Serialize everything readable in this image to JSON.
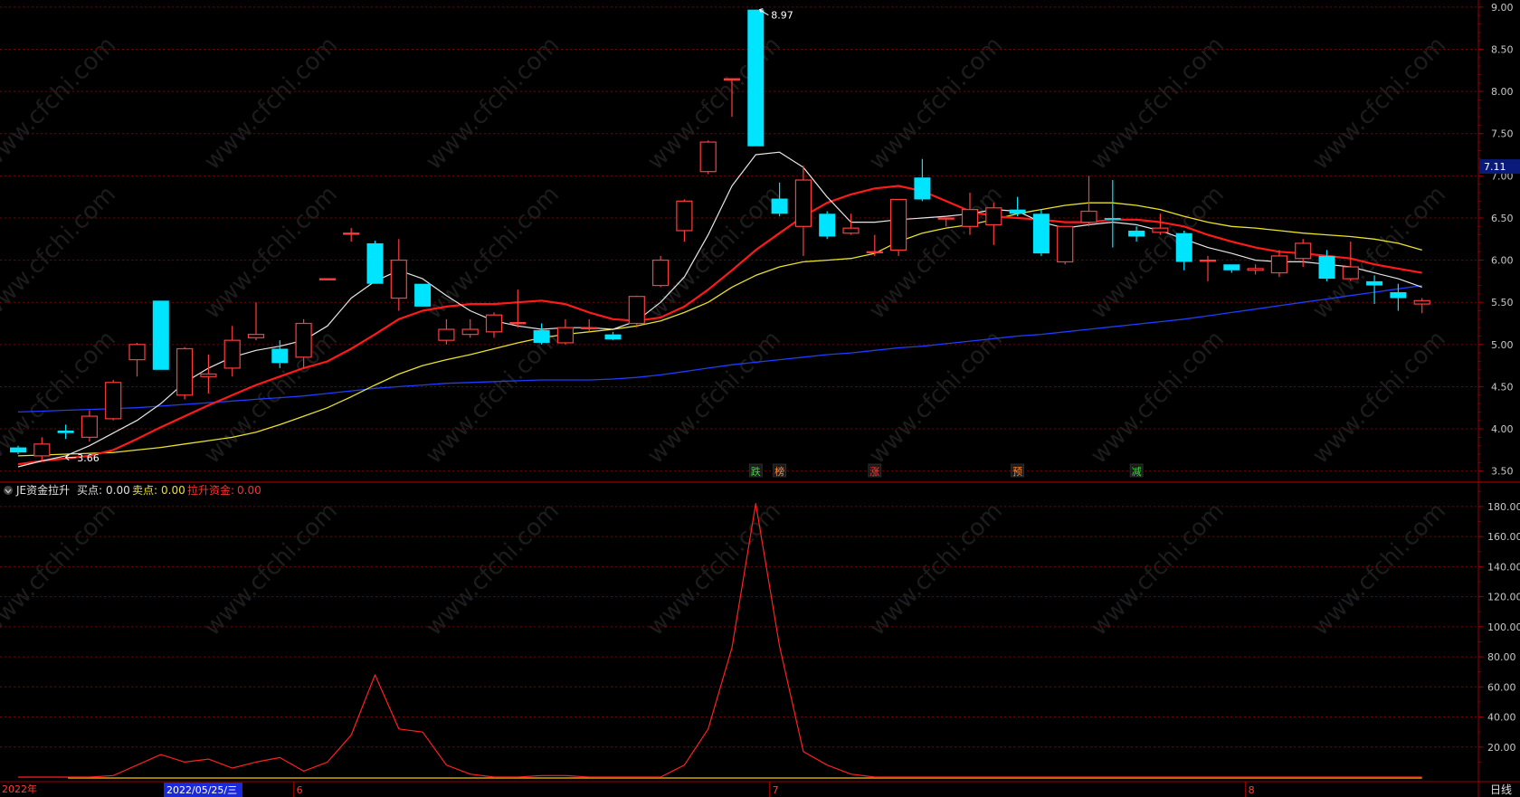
{
  "colors": {
    "background": "#000000",
    "grid": "#7a0000",
    "frame": "#9b0000",
    "up": "#ff3c3c",
    "down": "#00e5ff",
    "ma5": "#e6e6e6",
    "ma10": "#ff1a1a",
    "ma20": "#e8e22a",
    "ma60": "#1f3cff",
    "indicator": "#ff2020",
    "zero_line": "#d4a400",
    "axis_text": "#c8c8c8",
    "current_price_bg": "#0a1a7a",
    "date_bg": "#1a2ad8"
  },
  "main_panel": {
    "price_axis_ticks": [
      "9.00",
      "8.50",
      "8.00",
      "7.50",
      "7.00",
      "6.50",
      "6.00",
      "5.50",
      "5.00",
      "4.50",
      "4.00",
      "3.50"
    ],
    "current_price": "7.11",
    "high_annotation": "8.97",
    "low_annotation": "3.66",
    "event_markers": [
      {
        "label": "跌",
        "color": "#33dd33",
        "index": 31
      },
      {
        "label": "榜",
        "color": "#ff8a3c",
        "index": 32
      },
      {
        "label": "涨",
        "color": "#ff3c3c",
        "index": 36
      },
      {
        "label": "预",
        "color": "#ff8a3c",
        "index": 42
      },
      {
        "label": "减",
        "color": "#33dd33",
        "index": 47
      }
    ]
  },
  "indicator_panel": {
    "name": "JE资金拉升",
    "buy_label": "买点:",
    "buy_value": "0.00",
    "sell_label": "卖点:",
    "sell_value": "0.00",
    "rise_label": "拉升资金:",
    "rise_value": "0.00",
    "axis_ticks": [
      "180.00",
      "160.00",
      "140.00",
      "120.00",
      "100.00",
      "80.00",
      "60.00",
      "40.00",
      "20.00"
    ]
  },
  "date_axis": {
    "year": "2022年",
    "cursor_date": "2022/05/25/三",
    "months": [
      {
        "label": "6",
        "index": 12
      },
      {
        "label": "7",
        "index": 32
      },
      {
        "label": "8",
        "index": 52
      }
    ],
    "period": "日线"
  },
  "chart_data": {
    "type": "line",
    "candles": [
      {
        "o": 3.78,
        "h": 3.8,
        "l": 3.7,
        "c": 3.72
      },
      {
        "o": 3.68,
        "h": 3.9,
        "l": 3.62,
        "c": 3.82
      },
      {
        "o": 3.98,
        "h": 4.05,
        "l": 3.88,
        "c": 3.95
      },
      {
        "o": 3.9,
        "h": 4.22,
        "l": 3.85,
        "c": 4.15
      },
      {
        "o": 4.12,
        "h": 4.58,
        "l": 4.1,
        "c": 4.55
      },
      {
        "o": 4.82,
        "h": 5.02,
        "l": 4.62,
        "c": 5.0
      },
      {
        "o": 5.52,
        "h": 5.52,
        "l": 4.7,
        "c": 4.7
      },
      {
        "o": 4.4,
        "h": 4.97,
        "l": 4.35,
        "c": 4.95
      },
      {
        "o": 4.62,
        "h": 4.88,
        "l": 4.42,
        "c": 4.65
      },
      {
        "o": 4.72,
        "h": 5.22,
        "l": 4.62,
        "c": 5.05
      },
      {
        "o": 5.08,
        "h": 5.5,
        "l": 5.05,
        "c": 5.12
      },
      {
        "o": 4.95,
        "h": 5.05,
        "l": 4.72,
        "c": 4.78
      },
      {
        "o": 4.85,
        "h": 5.3,
        "l": 4.72,
        "c": 5.25
      },
      {
        "o": 5.78,
        "h": 5.78,
        "l": 5.76,
        "c": 5.78
      },
      {
        "o": 6.32,
        "h": 6.38,
        "l": 6.22,
        "c": 6.32
      },
      {
        "o": 6.2,
        "h": 6.23,
        "l": 5.72,
        "c": 5.72
      },
      {
        "o": 5.55,
        "h": 6.25,
        "l": 5.4,
        "c": 6.0
      },
      {
        "o": 5.72,
        "h": 5.72,
        "l": 5.45,
        "c": 5.45
      },
      {
        "o": 5.05,
        "h": 5.3,
        "l": 5.0,
        "c": 5.18
      },
      {
        "o": 5.12,
        "h": 5.3,
        "l": 5.08,
        "c": 5.18
      },
      {
        "o": 5.15,
        "h": 5.38,
        "l": 5.08,
        "c": 5.35
      },
      {
        "o": 5.25,
        "h": 5.65,
        "l": 5.2,
        "c": 5.26
      },
      {
        "o": 5.17,
        "h": 5.25,
        "l": 5.0,
        "c": 5.02
      },
      {
        "o": 5.02,
        "h": 5.3,
        "l": 5.0,
        "c": 5.2
      },
      {
        "o": 5.2,
        "h": 5.3,
        "l": 5.15,
        "c": 5.2
      },
      {
        "o": 5.12,
        "h": 5.15,
        "l": 5.05,
        "c": 5.06
      },
      {
        "o": 5.25,
        "h": 5.58,
        "l": 5.2,
        "c": 5.57
      },
      {
        "o": 5.7,
        "h": 6.05,
        "l": 5.68,
        "c": 6.0
      },
      {
        "o": 6.35,
        "h": 6.72,
        "l": 6.22,
        "c": 6.7
      },
      {
        "o": 7.05,
        "h": 7.42,
        "l": 7.02,
        "c": 7.4
      },
      {
        "o": 8.15,
        "h": 8.15,
        "l": 7.7,
        "c": 8.15
      },
      {
        "o": 8.97,
        "h": 8.97,
        "l": 7.35,
        "c": 7.35
      },
      {
        "o": 6.73,
        "h": 6.92,
        "l": 6.52,
        "c": 6.55
      },
      {
        "o": 6.4,
        "h": 7.12,
        "l": 6.05,
        "c": 6.95
      },
      {
        "o": 6.55,
        "h": 6.58,
        "l": 6.25,
        "c": 6.28
      },
      {
        "o": 6.32,
        "h": 6.55,
        "l": 6.3,
        "c": 6.38
      },
      {
        "o": 6.1,
        "h": 6.3,
        "l": 6.05,
        "c": 6.1
      },
      {
        "o": 6.12,
        "h": 6.72,
        "l": 6.05,
        "c": 6.72
      },
      {
        "o": 6.98,
        "h": 7.2,
        "l": 6.7,
        "c": 6.72
      },
      {
        "o": 6.5,
        "h": 6.5,
        "l": 6.4,
        "c": 6.5
      },
      {
        "o": 6.4,
        "h": 6.8,
        "l": 6.3,
        "c": 6.6
      },
      {
        "o": 6.42,
        "h": 6.68,
        "l": 6.18,
        "c": 6.62
      },
      {
        "o": 6.6,
        "h": 6.75,
        "l": 6.52,
        "c": 6.55
      },
      {
        "o": 6.55,
        "h": 6.6,
        "l": 6.05,
        "c": 6.08
      },
      {
        "o": 5.98,
        "h": 6.4,
        "l": 5.95,
        "c": 6.4
      },
      {
        "o": 6.45,
        "h": 7.0,
        "l": 6.4,
        "c": 6.58
      },
      {
        "o": 6.5,
        "h": 6.95,
        "l": 6.15,
        "c": 6.48
      },
      {
        "o": 6.35,
        "h": 6.4,
        "l": 6.22,
        "c": 6.28
      },
      {
        "o": 6.33,
        "h": 6.55,
        "l": 6.3,
        "c": 6.38
      },
      {
        "o": 6.32,
        "h": 6.35,
        "l": 5.88,
        "c": 5.98
      },
      {
        "o": 6.0,
        "h": 6.05,
        "l": 5.75,
        "c": 6.0
      },
      {
        "o": 5.95,
        "h": 5.95,
        "l": 5.85,
        "c": 5.88
      },
      {
        "o": 5.88,
        "h": 5.95,
        "l": 5.83,
        "c": 5.9
      },
      {
        "o": 5.85,
        "h": 6.12,
        "l": 5.8,
        "c": 6.05
      },
      {
        "o": 6.02,
        "h": 6.25,
        "l": 5.92,
        "c": 6.2
      },
      {
        "o": 6.05,
        "h": 6.12,
        "l": 5.75,
        "c": 5.78
      },
      {
        "o": 5.78,
        "h": 6.22,
        "l": 5.75,
        "c": 5.92
      },
      {
        "o": 5.75,
        "h": 5.82,
        "l": 5.48,
        "c": 5.7
      },
      {
        "o": 5.62,
        "h": 5.72,
        "l": 5.4,
        "c": 5.55
      },
      {
        "o": 5.48,
        "h": 5.55,
        "l": 5.37,
        "c": 5.52
      }
    ],
    "ma5": [
      3.55,
      3.62,
      3.68,
      3.8,
      3.95,
      4.1,
      4.3,
      4.55,
      4.72,
      4.85,
      4.93,
      4.98,
      5.05,
      5.22,
      5.55,
      5.75,
      5.88,
      5.78,
      5.58,
      5.4,
      5.28,
      5.22,
      5.18,
      5.2,
      5.2,
      5.18,
      5.28,
      5.5,
      5.8,
      6.3,
      6.88,
      7.25,
      7.28,
      7.1,
      6.75,
      6.45,
      6.45,
      6.48,
      6.5,
      6.52,
      6.55,
      6.6,
      6.58,
      6.45,
      6.38,
      6.42,
      6.45,
      6.42,
      6.35,
      6.25,
      6.15,
      6.08,
      6.0,
      5.98,
      5.98,
      5.95,
      5.92,
      5.85,
      5.78,
      5.68
    ],
    "ma10": [
      3.58,
      3.62,
      3.65,
      3.68,
      3.75,
      3.88,
      4.02,
      4.15,
      4.28,
      4.4,
      4.52,
      4.62,
      4.72,
      4.8,
      4.95,
      5.12,
      5.3,
      5.4,
      5.45,
      5.48,
      5.48,
      5.5,
      5.52,
      5.48,
      5.38,
      5.3,
      5.28,
      5.32,
      5.45,
      5.65,
      5.88,
      6.12,
      6.32,
      6.52,
      6.68,
      6.78,
      6.85,
      6.88,
      6.82,
      6.7,
      6.58,
      6.52,
      6.5,
      6.48,
      6.45,
      6.45,
      6.48,
      6.48,
      6.45,
      6.4,
      6.3,
      6.22,
      6.15,
      6.1,
      6.08,
      6.05,
      6.02,
      5.95,
      5.9,
      5.85
    ],
    "ma20": [
      3.68,
      3.69,
      3.7,
      3.71,
      3.72,
      3.75,
      3.78,
      3.82,
      3.86,
      3.9,
      3.96,
      4.05,
      4.15,
      4.25,
      4.38,
      4.52,
      4.65,
      4.75,
      4.82,
      4.88,
      4.95,
      5.02,
      5.08,
      5.12,
      5.15,
      5.18,
      5.22,
      5.28,
      5.38,
      5.5,
      5.68,
      5.82,
      5.92,
      5.98,
      6.0,
      6.02,
      6.08,
      6.22,
      6.32,
      6.38,
      6.42,
      6.48,
      6.55,
      6.6,
      6.65,
      6.68,
      6.68,
      6.65,
      6.6,
      6.52,
      6.45,
      6.4,
      6.38,
      6.35,
      6.32,
      6.3,
      6.28,
      6.25,
      6.2,
      6.12
    ],
    "ma60": [
      4.2,
      4.21,
      4.22,
      4.23,
      4.24,
      4.25,
      4.27,
      4.29,
      4.31,
      4.33,
      4.35,
      4.37,
      4.39,
      4.42,
      4.45,
      4.48,
      4.5,
      4.52,
      4.54,
      4.55,
      4.56,
      4.57,
      4.58,
      4.58,
      4.58,
      4.59,
      4.61,
      4.64,
      4.68,
      4.72,
      4.76,
      4.79,
      4.82,
      4.85,
      4.88,
      4.9,
      4.93,
      4.96,
      4.98,
      5.01,
      5.04,
      5.07,
      5.1,
      5.12,
      5.15,
      5.18,
      5.21,
      5.24,
      5.27,
      5.3,
      5.34,
      5.38,
      5.42,
      5.46,
      5.5,
      5.54,
      5.58,
      5.62,
      5.66,
      5.7
    ],
    "indicator": [
      0,
      0,
      0,
      0,
      1,
      8,
      15,
      10,
      12,
      6,
      10,
      13,
      4,
      10,
      28,
      68,
      32,
      30,
      8,
      2,
      0,
      0,
      1,
      1,
      0,
      0,
      0,
      0,
      8,
      32,
      86,
      182,
      87,
      17,
      8,
      2,
      0,
      0,
      0,
      0,
      0,
      0,
      0,
      0,
      0,
      0,
      0,
      0,
      0,
      0,
      0,
      0,
      0,
      0,
      0,
      0,
      0,
      0,
      0,
      0
    ],
    "price_range": [
      3.4,
      9.02
    ],
    "indicator_range": [
      0,
      195
    ]
  }
}
